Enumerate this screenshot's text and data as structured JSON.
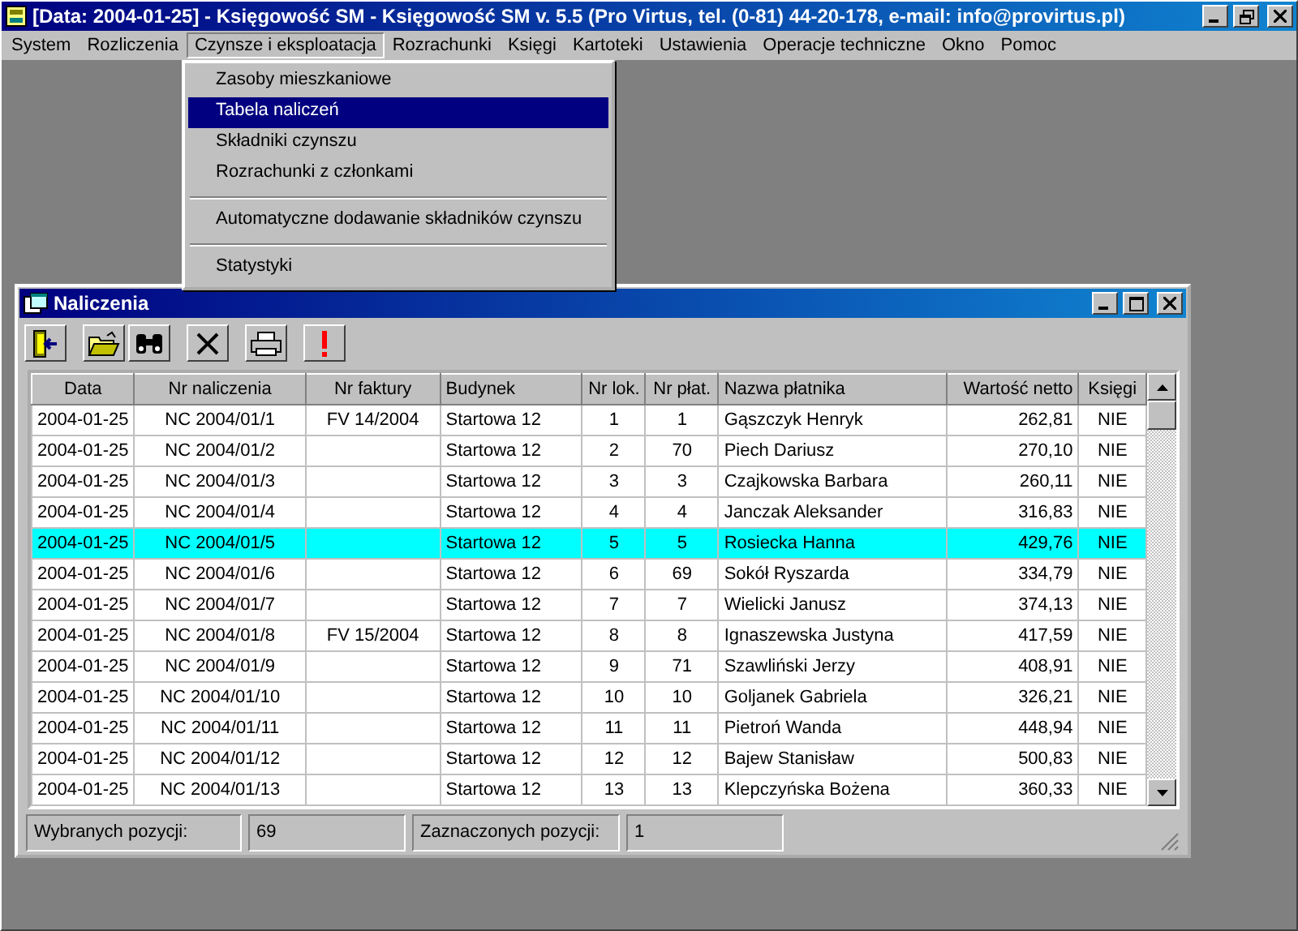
{
  "window": {
    "title": "[Data: 2004-01-25] - Księgowość SM - Księgowość SM v. 5.5 (Pro Virtus, tel. (0-81) 44-20-178, e-mail: info@provirtus.pl)"
  },
  "menu": [
    {
      "label": "System",
      "selected": false
    },
    {
      "label": "Rozliczenia",
      "selected": false
    },
    {
      "label": "Czynsze i eksploatacja",
      "selected": true
    },
    {
      "label": "Rozrachunki",
      "selected": false
    },
    {
      "label": "Księgi",
      "selected": false
    },
    {
      "label": "Kartoteki",
      "selected": false
    },
    {
      "label": "Ustawienia",
      "selected": false
    },
    {
      "label": "Operacje techniczne",
      "selected": false
    },
    {
      "label": "Okno",
      "selected": false
    },
    {
      "label": "Pomoc",
      "selected": false
    }
  ],
  "dropdown": {
    "sections": [
      {
        "items": [
          {
            "label": "Zasoby mieszkaniowe",
            "selected": false
          },
          {
            "label": "Tabela naliczeń",
            "selected": true
          },
          {
            "label": "Składniki czynszu",
            "selected": false
          },
          {
            "label": "Rozrachunki z członkami",
            "selected": false
          }
        ]
      },
      {
        "items": [
          {
            "label": "Automatyczne dodawanie składników czynszu",
            "selected": false
          }
        ]
      },
      {
        "items": [
          {
            "label": "Statystyki",
            "selected": false
          }
        ]
      }
    ]
  },
  "child_window": {
    "title": "Naliczenia",
    "table": {
      "columns": [
        "Data",
        "Nr naliczenia",
        "Nr faktury",
        "Budynek",
        "Nr lok.",
        "Nr płat.",
        "Nazwa płatnika",
        "Wartość netto",
        "Księgi"
      ],
      "rows": [
        {
          "selected": false,
          "cells": [
            "2004-01-25",
            "NC 2004/01/1",
            "FV 14/2004",
            "Startowa 12",
            "1",
            "1",
            "Gąszczyk Henryk",
            "262,81",
            "NIE"
          ]
        },
        {
          "selected": false,
          "cells": [
            "2004-01-25",
            "NC 2004/01/2",
            "",
            "Startowa 12",
            "2",
            "70",
            "Piech Dariusz",
            "270,10",
            "NIE"
          ]
        },
        {
          "selected": false,
          "cells": [
            "2004-01-25",
            "NC 2004/01/3",
            "",
            "Startowa 12",
            "3",
            "3",
            "Czajkowska Barbara",
            "260,11",
            "NIE"
          ]
        },
        {
          "selected": false,
          "cells": [
            "2004-01-25",
            "NC 2004/01/4",
            "",
            "Startowa 12",
            "4",
            "4",
            "Janczak Aleksander",
            "316,83",
            "NIE"
          ]
        },
        {
          "selected": true,
          "cells": [
            "2004-01-25",
            "NC 2004/01/5",
            "",
            "Startowa 12",
            "5",
            "5",
            "Rosiecka Hanna",
            "429,76",
            "NIE"
          ]
        },
        {
          "selected": false,
          "cells": [
            "2004-01-25",
            "NC 2004/01/6",
            "",
            "Startowa 12",
            "6",
            "69",
            "Sokół Ryszarda",
            "334,79",
            "NIE"
          ]
        },
        {
          "selected": false,
          "cells": [
            "2004-01-25",
            "NC 2004/01/7",
            "",
            "Startowa 12",
            "7",
            "7",
            "Wielicki Janusz",
            "374,13",
            "NIE"
          ]
        },
        {
          "selected": false,
          "cells": [
            "2004-01-25",
            "NC 2004/01/8",
            "FV 15/2004",
            "Startowa 12",
            "8",
            "8",
            "Ignaszewska Justyna",
            "417,59",
            "NIE"
          ]
        },
        {
          "selected": false,
          "cells": [
            "2004-01-25",
            "NC 2004/01/9",
            "",
            "Startowa 12",
            "9",
            "71",
            "Szawliński Jerzy",
            "408,91",
            "NIE"
          ]
        },
        {
          "selected": false,
          "cells": [
            "2004-01-25",
            "NC 2004/01/10",
            "",
            "Startowa 12",
            "10",
            "10",
            "Goljanek Gabriela",
            "326,21",
            "NIE"
          ]
        },
        {
          "selected": false,
          "cells": [
            "2004-01-25",
            "NC 2004/01/11",
            "",
            "Startowa 12",
            "11",
            "11",
            "Pietroń Wanda",
            "448,94",
            "NIE"
          ]
        },
        {
          "selected": false,
          "cells": [
            "2004-01-25",
            "NC 2004/01/12",
            "",
            "Startowa 12",
            "12",
            "12",
            "Bajew Stanisław",
            "500,83",
            "NIE"
          ]
        },
        {
          "selected": false,
          "cells": [
            "2004-01-25",
            "NC 2004/01/13",
            "",
            "Startowa 12",
            "13",
            "13",
            "Klepczyńska Bożena",
            "360,33",
            "NIE"
          ]
        }
      ]
    },
    "status_bar": [
      {
        "label": "Wybranych pozycji:",
        "value": "69"
      },
      {
        "label": "Zaznaczonych pozycji:",
        "value": "1"
      }
    ]
  }
}
